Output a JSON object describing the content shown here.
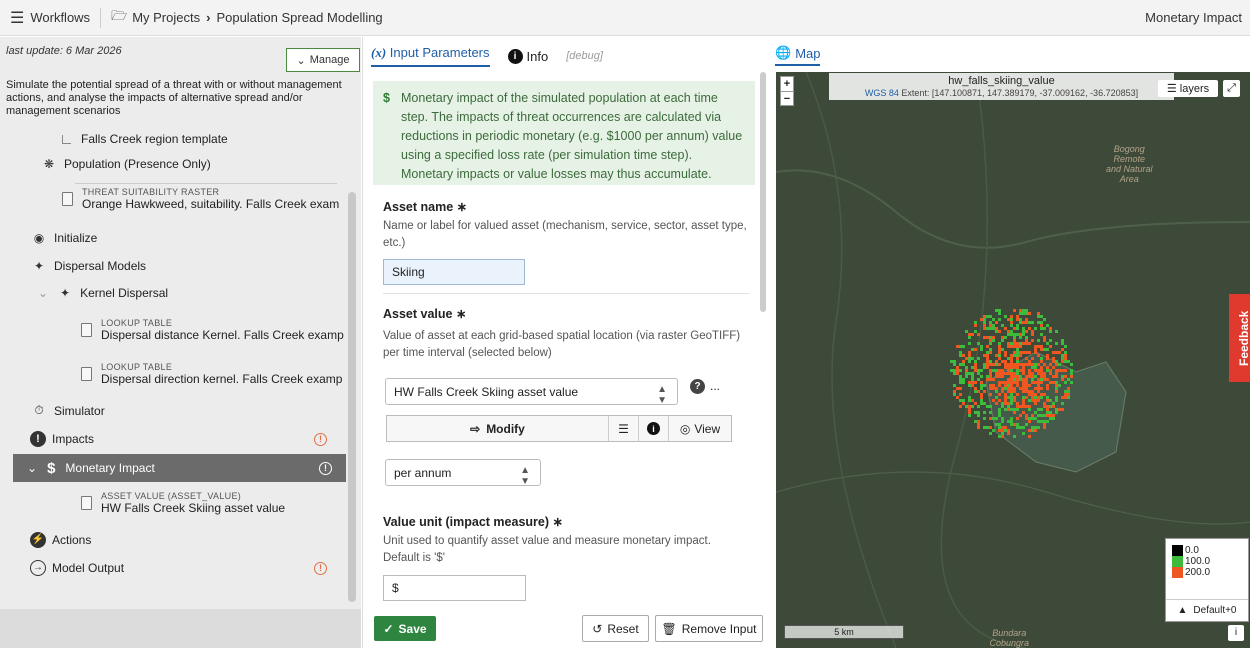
{
  "header": {
    "workflows": "Workflows",
    "project": "My Projects",
    "page": "Population Spread Modelling",
    "right": "Monetary Impact"
  },
  "sidebar": {
    "last_update": "last update: 6 Mar 2026",
    "manage": "Manage",
    "description": "Simulate the potential spread of a threat with or without management actions, and analyse the impacts of alternative spread and/or management scenarios",
    "falls_creek": "Falls Creek region template",
    "population": "Population (Presence Only)",
    "threat_cap": "THREAT SUITABILITY RASTER",
    "threat_val": "Orange Hawkweed, suitability. Falls Creek exam",
    "initialize": "Initialize",
    "dispersal_models": "Dispersal Models",
    "kernel_dispersal": "Kernel Dispersal",
    "lookup1_cap": "LOOKUP TABLE",
    "lookup1_val": "Dispersal distance Kernel. Falls Creek examp",
    "lookup2_cap": "LOOKUP TABLE",
    "lookup2_val": "Dispersal direction kernel. Falls Creek examp",
    "simulator": "Simulator",
    "impacts": "Impacts",
    "monetary_impact": "Monetary Impact",
    "asset_cap": "ASSET VALUE (ASSET_VALUE)",
    "asset_val": "HW Falls Creek Skiing asset value",
    "actions": "Actions",
    "model_output": "Model Output"
  },
  "tabs": {
    "input_parameters": "Input Parameters",
    "info": "Info",
    "debug": "[debug]"
  },
  "notice": "Monetary impact of the simulated population at each time step. The impacts of threat occurrences are calculated via reductions in periodic monetary (e.g. $1000 per annum) value using a specified loss rate (per simulation time step). Monetary impacts or value losses may thus accumulate.",
  "form": {
    "asset_name_label": "Asset name ∗",
    "asset_name_help": "Name or label for valued asset (mechanism, service, sector, asset type, etc.)",
    "asset_name_value": "Skiing",
    "asset_value_label": "Asset value ∗",
    "asset_value_help": "Value of asset at each grid-based spatial location (via raster GeoTIFF) per time interval (selected below)",
    "asset_value_select": "HW Falls Creek Skiing asset value",
    "more": "...",
    "modify": "Modify",
    "view": "View",
    "period_select": "per annum",
    "value_unit_label": "Value unit (impact measure) ∗",
    "value_unit_help": "Unit used to quantify asset value and measure monetary impact. Default is '$'",
    "value_unit_value": "$"
  },
  "footer": {
    "save": "Save",
    "reset": "Reset",
    "remove": "Remove Input"
  },
  "map": {
    "tab": "Map",
    "layer_name": "hw_falls_skiing_value",
    "crs": "WGS 84",
    "extent": "Extent: [147.100871, 147.389179, -37.009162, -36.720853]",
    "layers": "layers",
    "feedback": "Feedback",
    "legend": [
      {
        "label": "0.0",
        "color": "#000000"
      },
      {
        "label": "100.0",
        "color": "#3dbb3d"
      },
      {
        "label": "200.0",
        "color": "#f0561f"
      }
    ],
    "legend_default": "Default+0",
    "scale": "5 km",
    "place1": "Bogong\nRemote\nand Natural\nArea",
    "place2": "Bundara\nCobungra\nRemote\nand Natural"
  }
}
